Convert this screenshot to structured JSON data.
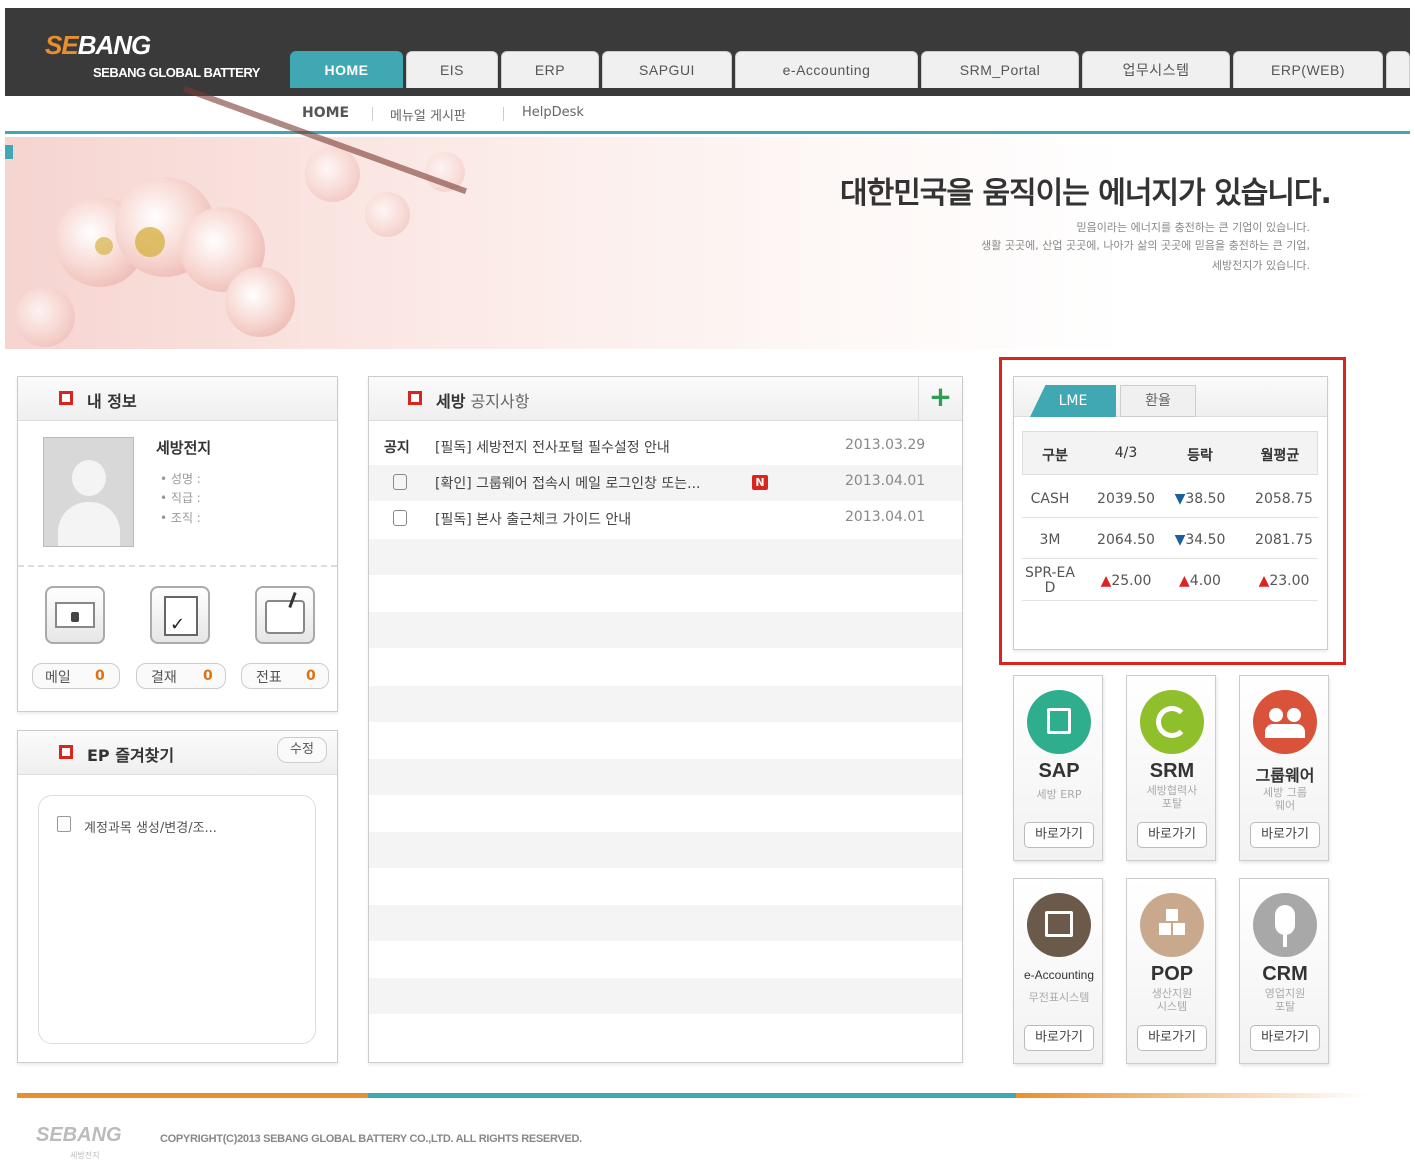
{
  "header": {
    "logo_brand": "SEBANG",
    "logo_sub": "SEBANG GLOBAL BATTERY",
    "tabs": [
      "HOME",
      "EIS",
      "ERP",
      "SAPGUI",
      "e-Accounting",
      "SRM_Portal",
      "업무시스템",
      "ERP(WEB)"
    ],
    "active_tab": "HOME",
    "accent_color": "#3fa8b2"
  },
  "subnav": {
    "items": [
      "HOME",
      "메뉴얼 게시판",
      "HelpDesk"
    ]
  },
  "banner": {
    "title": "대한민국을 움직이는 에너지가 있습니다.",
    "lines": [
      "믿음이라는 에너지를 충전하는 큰 기업이 있습니다.",
      "생활 곳곳에, 산업 곳곳에, 나아가 삶의 곳곳에 믿음을 충전하는 큰 기업,",
      "세방전지가 있습니다."
    ]
  },
  "myinfo": {
    "title": "내 정보",
    "name": "세방전지",
    "fields": [
      "성명 :",
      "직급 :",
      "조직 :"
    ],
    "buttons": [
      {
        "label": "메일",
        "count": "0"
      },
      {
        "label": "결재",
        "count": "0"
      },
      {
        "label": "전표",
        "count": "0"
      }
    ]
  },
  "favorites": {
    "title": "EP 즐겨찾기",
    "edit_label": "수정",
    "items": [
      "계정과목 생성/변경/조..."
    ]
  },
  "notice": {
    "title_strong": "세방",
    "title_rest": " 공지사항",
    "plus": "+",
    "rows": [
      {
        "tag": "공지",
        "title": "[필독] 세방전지 전사포털 필수설정 안내",
        "date": "2013.03.29",
        "is_new": false
      },
      {
        "tag": "",
        "title": "[확인] 그룹웨어 접속시 메일 로그인창 또는...",
        "date": "2013.04.01",
        "is_new": true
      },
      {
        "tag": "",
        "title": "[필독] 본사 출근체크 가이드 안내",
        "date": "2013.04.01",
        "is_new": false
      }
    ],
    "new_badge": "N"
  },
  "lme": {
    "tabs": [
      "LME",
      "환율"
    ],
    "headers": [
      "구분",
      "4/3",
      "등락",
      "월평균"
    ],
    "rows": [
      {
        "name": "CASH",
        "value": "2039.50",
        "change": "38.50",
        "dir": "down",
        "avg": "2058.75"
      },
      {
        "name": "3M",
        "value": "2064.50",
        "change": "34.50",
        "dir": "down",
        "avg": "2081.75"
      },
      {
        "name": "SPR-EAD",
        "value": "25.00",
        "value_dir": "up",
        "change": "4.00",
        "dir": "up",
        "avg": "23.00",
        "avg_dir": "up"
      }
    ]
  },
  "apps": [
    {
      "name": "SAP",
      "desc": "세방 ERP",
      "go": "바로가기",
      "color": "#2fae8e",
      "icon": "building-icon"
    },
    {
      "name": "SRM",
      "desc": "세방협력사 포탈",
      "go": "바로가기",
      "color": "#8fbf2a",
      "icon": "cycle-icon"
    },
    {
      "name": "그룹웨어",
      "desc": "세방 그룹웨어",
      "go": "바로가기",
      "color": "#d9523a",
      "icon": "people-icon"
    },
    {
      "name": "e-Accounting",
      "desc": "무전표시스템",
      "go": "바로가기",
      "color": "#6b5a4a",
      "icon": "document-icon"
    },
    {
      "name": "POP",
      "desc": "생산지원 시스템",
      "go": "바로가기",
      "color": "#c9a98e",
      "icon": "boxes-icon"
    },
    {
      "name": "CRM",
      "desc": "영업지원 포탈",
      "go": "바로가기",
      "color": "#a8a8a8",
      "icon": "mouse-icon"
    }
  ],
  "footer": {
    "logo": "SEBANG",
    "logo_sub": "세방전지",
    "copyright": "COPYRIGHT(C)2013 SEBANG GLOBAL BATTERY CO.,LTD. ALL RIGHTS RESERVED."
  }
}
